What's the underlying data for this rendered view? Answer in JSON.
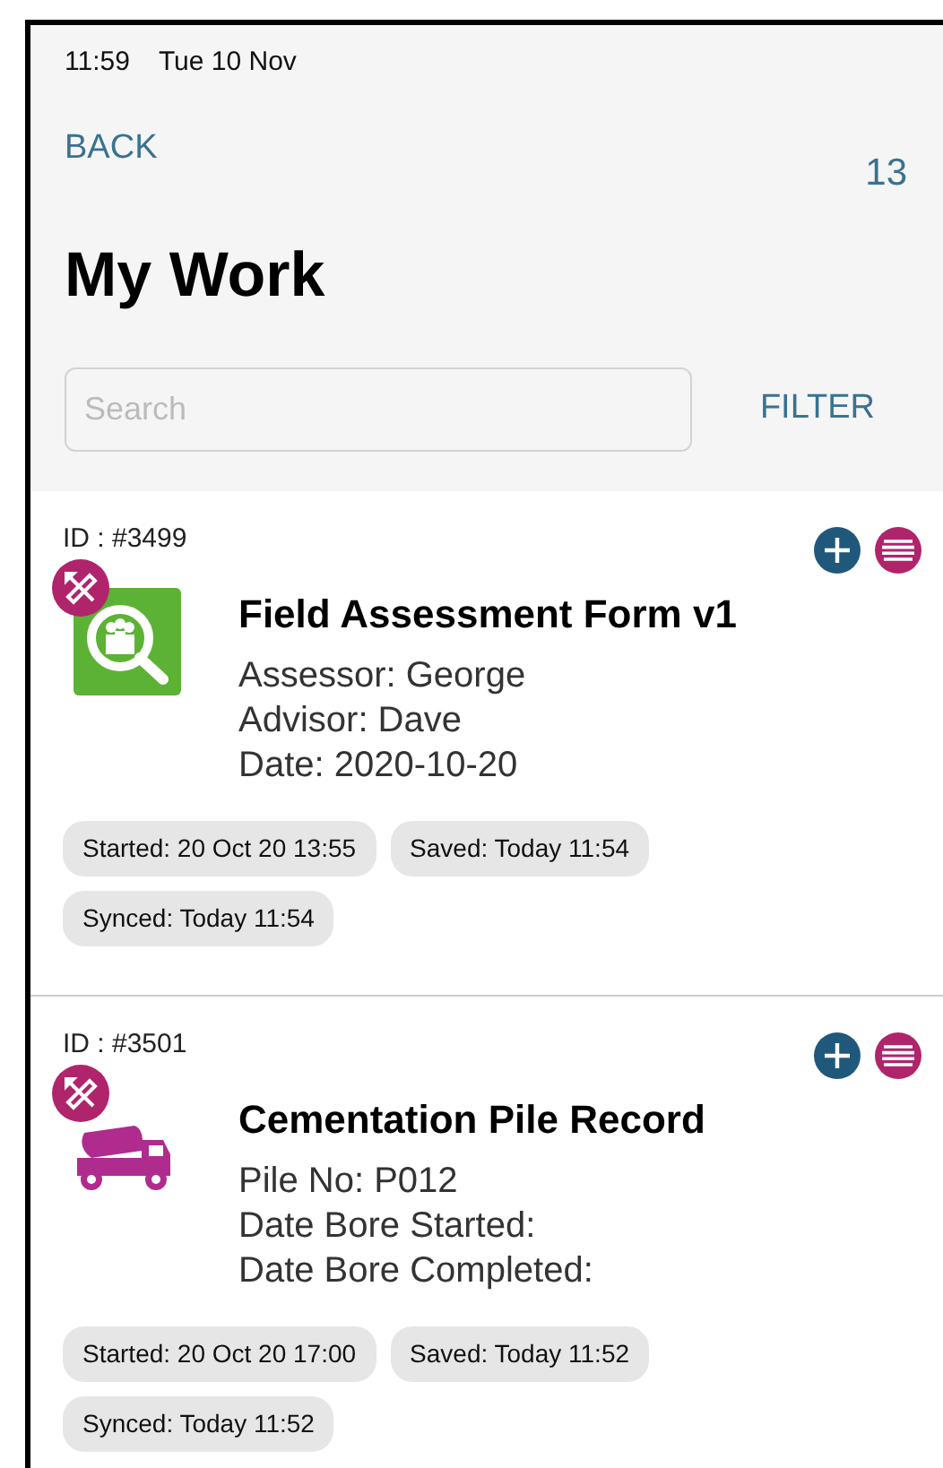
{
  "status_bar": {
    "time": "11:59",
    "date": "Tue 10 Nov"
  },
  "nav": {
    "back": "BACK",
    "count": "13"
  },
  "title": "My Work",
  "search": {
    "placeholder": "Search"
  },
  "filter": "FILTER",
  "items": [
    {
      "id": "ID : #3499",
      "kind": "assessment",
      "title": "Field Assessment Form v1",
      "details": [
        "Assessor: George",
        "Advisor: Dave",
        "Date: 2020-10-20"
      ],
      "tags": [
        "Started: 20 Oct 20 13:55",
        "Saved: Today 11:54",
        "Synced: Today 11:54"
      ]
    },
    {
      "id": "ID : #3501",
      "kind": "truck",
      "title": "Cementation Pile Record",
      "details": [
        "Pile No: P012",
        "Date Bore Started:",
        "Date Bore Completed:"
      ],
      "tags": [
        "Started: 20 Oct 20 17:00",
        "Saved: Today 11:52",
        "Synced: Today 11:52"
      ]
    }
  ]
}
